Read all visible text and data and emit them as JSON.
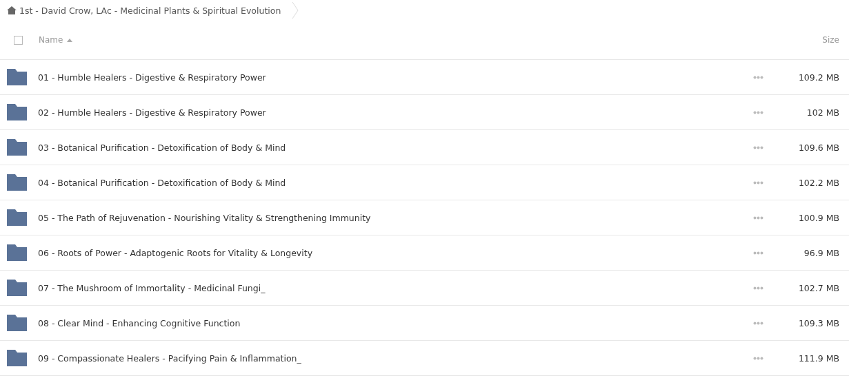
{
  "breadcrumb": {
    "title": "1st - David Crow, LAc - Medicinal Plants & Spiritual Evolution"
  },
  "table": {
    "select_all": {
      "checked": false
    },
    "columns": [
      {
        "label": "Name",
        "sorted": true
      },
      {
        "label": "Size",
        "sorted": false
      }
    ],
    "rows": [
      {
        "kind": "folder",
        "name": "01 - Humble Healers - Digestive & Respiratory Power",
        "size": "109.2 MB"
      },
      {
        "kind": "folder",
        "name": "02 - Humble Healers - Digestive & Respiratory Power",
        "size": "102 MB"
      },
      {
        "kind": "folder",
        "name": "03 - Botanical Purification - Detoxification of Body & Mind",
        "size": "109.6 MB"
      },
      {
        "kind": "folder",
        "name": "04 - Botanical Purification - Detoxification of Body & Mind",
        "size": "102.2 MB"
      },
      {
        "kind": "folder",
        "name": "05 - The Path of Rejuvenation - Nourishing Vitality & Strengthening Immunity",
        "size": "100.9 MB"
      },
      {
        "kind": "folder",
        "name": "06 - Roots of Power - Adaptogenic Roots for Vitality & Longevity",
        "size": "96.9 MB"
      },
      {
        "kind": "folder",
        "name": "07 - The Mushroom of Immortality - Medicinal Fungi_",
        "size": "102.7 MB"
      },
      {
        "kind": "folder",
        "name": "08 - Clear Mind - Enhancing Cognitive Function",
        "size": "109.3 MB"
      },
      {
        "kind": "folder",
        "name": "09 - Compassionate Healers - Pacifying Pain & Inflammation_",
        "size": "111.9 MB"
      }
    ]
  }
}
